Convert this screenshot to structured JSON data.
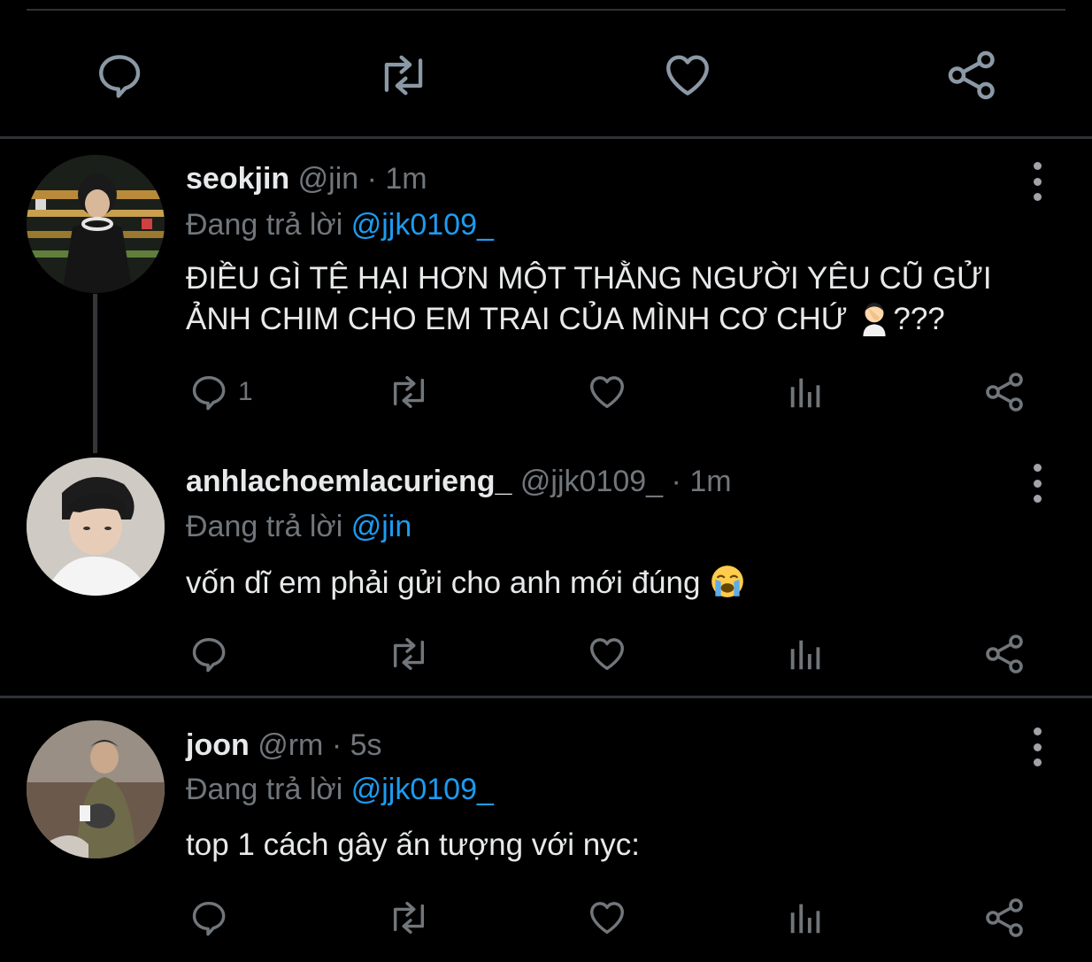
{
  "tweets": [
    {
      "name": "seokjin",
      "handle": "@jin",
      "dot": "·",
      "time": "1m",
      "reply_prefix": "Đang trả lời",
      "reply_to": "@jjk0109_",
      "text_line1": "ĐIỀU GÌ TỆ HẠI HƠN MỘT THẰNG NGƯỜI YÊU CŨ GỬI",
      "text_line2": "ẢNH CHIM CHO EM TRAI CỦA MÌNH CƠ CHỨ",
      "text_suffix": "???",
      "emoji": "facepalm-emoji",
      "reply_count": "1"
    },
    {
      "name": "anhlachoemlacurieng_",
      "handle": "@jjk0109_",
      "dot": "·",
      "time": "1m",
      "reply_prefix": "Đang trả lời",
      "reply_to": "@jin",
      "text": "vốn dĩ em phải gửi cho anh mới đúng",
      "emoji": "loudly-crying-emoji"
    },
    {
      "name": "joon",
      "handle": "@rm",
      "dot": "·",
      "time": "5s",
      "reply_prefix": "Đang trả lời",
      "reply_to": "@jjk0109_",
      "text": "top 1 cách gây ấn tượng với nyc:"
    }
  ],
  "colors": {
    "background": "#000000",
    "text": "#e7e9ea",
    "muted": "#71767b",
    "accent": "#1d9bf0",
    "divider": "#2f3336"
  }
}
